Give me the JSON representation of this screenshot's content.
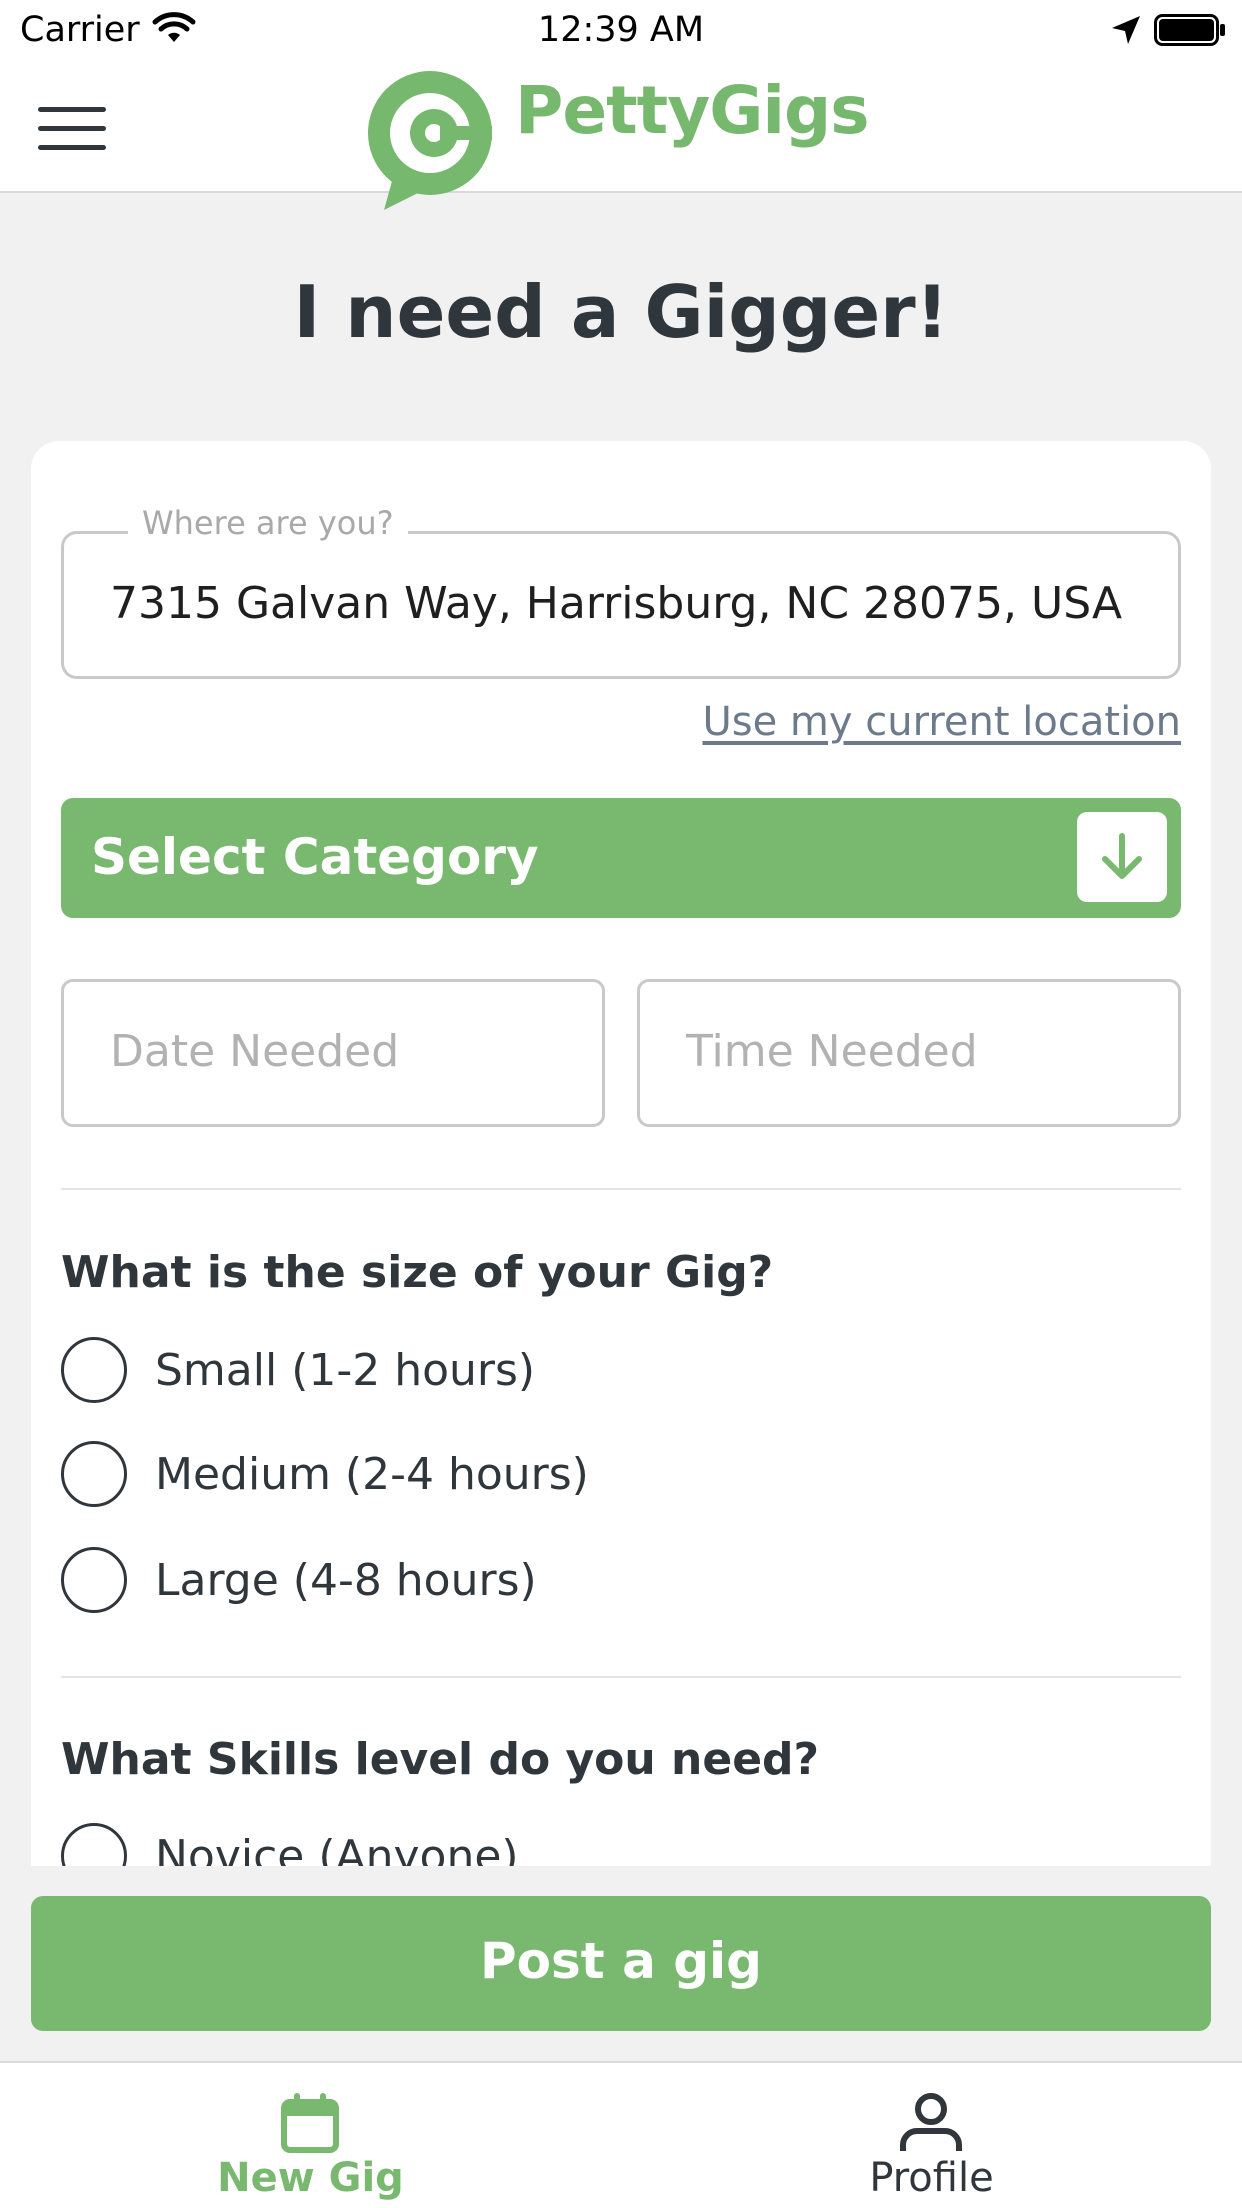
{
  "status_bar": {
    "carrier": "Carrier",
    "time": "12:39 AM"
  },
  "header": {
    "brand": "PettyGigs"
  },
  "page": {
    "title": "I need a Gigger!"
  },
  "form": {
    "location_label": "Where are you?",
    "location_value": "7315 Galvan Way, Harrisburg, NC 28075, USA",
    "use_location_link": "Use my current location",
    "category_label": "Select Category",
    "date_placeholder": "Date Needed",
    "time_placeholder": "Time Needed",
    "size_heading": "What is the size of your Gig?",
    "size_options": [
      "Small (1-2 hours)",
      "Medium (2-4 hours)",
      "Large (4-8 hours)"
    ],
    "skill_heading": "What Skills level do you need?",
    "skill_options": [
      "Novice (Anyone)"
    ]
  },
  "post_button_label": "Post a gig",
  "tabs": [
    {
      "label": "New Gig",
      "icon": "calendar-icon",
      "active": true
    },
    {
      "label": "Profile",
      "icon": "person-icon",
      "active": false
    }
  ],
  "colors": {
    "accent": "#79b86f",
    "text": "#2f363c",
    "link": "#6d7a8c"
  }
}
